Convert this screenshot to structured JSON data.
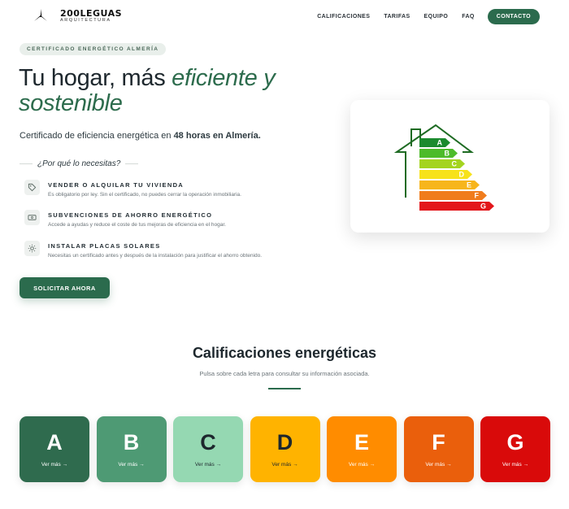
{
  "brand": {
    "name": "200LEGUAS",
    "subtitle": "ARQUITECTURA"
  },
  "nav": {
    "links": [
      "CALIFICACIONES",
      "TARIFAS",
      "EQUIPO",
      "FAQ"
    ],
    "cta": "CONTACTO"
  },
  "hero": {
    "badge": "CERTIFICADO ENERGÉTICO ALMERÍA",
    "title_plain": "Tu hogar, más ",
    "title_accent": "eficiente y sostenible",
    "subtitle_prefix": "Certificado de eficiencia energética en ",
    "subtitle_bold": "48 horas en Almería.",
    "why_title": "¿Por qué lo necesitas?",
    "reasons": [
      {
        "icon": "tag-icon",
        "title": "VENDER O ALQUILAR TU VIVIENDA",
        "desc": "Es obligatorio por ley. Sin el certificado, no puedes cerrar la operación inmobiliaria."
      },
      {
        "icon": "money-icon",
        "title": "SUBVENCIONES DE AHORRO ENERGÉTICO",
        "desc": "Accede a ayudas y reduce el coste de tus mejoras de eficiencia en el hogar."
      },
      {
        "icon": "sun-icon",
        "title": "INSTALAR PLACAS SOLARES",
        "desc": "Necesitas un certificado antes y después de la instalación para justificar el ahorro obtenido."
      }
    ],
    "cta": "SOLICITAR AHORA",
    "energy_labels": [
      "A",
      "B",
      "C",
      "D",
      "E",
      "F",
      "G"
    ]
  },
  "ratings": {
    "title": "Calificaciones energéticas",
    "subtitle": "Pulsa sobre cada letra para consultar su información asociada.",
    "cards": [
      {
        "letter": "A",
        "more": "Ver más",
        "bg": "#2f6b4e",
        "fg": "#ffffff"
      },
      {
        "letter": "B",
        "more": "Ver más",
        "bg": "#4e9a74",
        "fg": "#ffffff"
      },
      {
        "letter": "C",
        "more": "Ver más",
        "bg": "#95d8b2",
        "fg": "#1d272d"
      },
      {
        "letter": "D",
        "more": "Ver más",
        "bg": "#ffb300",
        "fg": "#1d272d"
      },
      {
        "letter": "E",
        "more": "Ver más",
        "bg": "#ff8c00",
        "fg": "#ffffff"
      },
      {
        "letter": "F",
        "more": "Ver más",
        "bg": "#ea5f0c",
        "fg": "#ffffff"
      },
      {
        "letter": "G",
        "more": "Ver más",
        "bg": "#d90a0a",
        "fg": "#ffffff"
      }
    ]
  },
  "colors": {
    "primary": "#2b6b4d",
    "accent_text": "#2d6c4d",
    "energy_scale": [
      "#1b8a2e",
      "#4dbb2a",
      "#a4d41f",
      "#f7e21a",
      "#f7b51b",
      "#f07c1c",
      "#e3171b"
    ]
  }
}
